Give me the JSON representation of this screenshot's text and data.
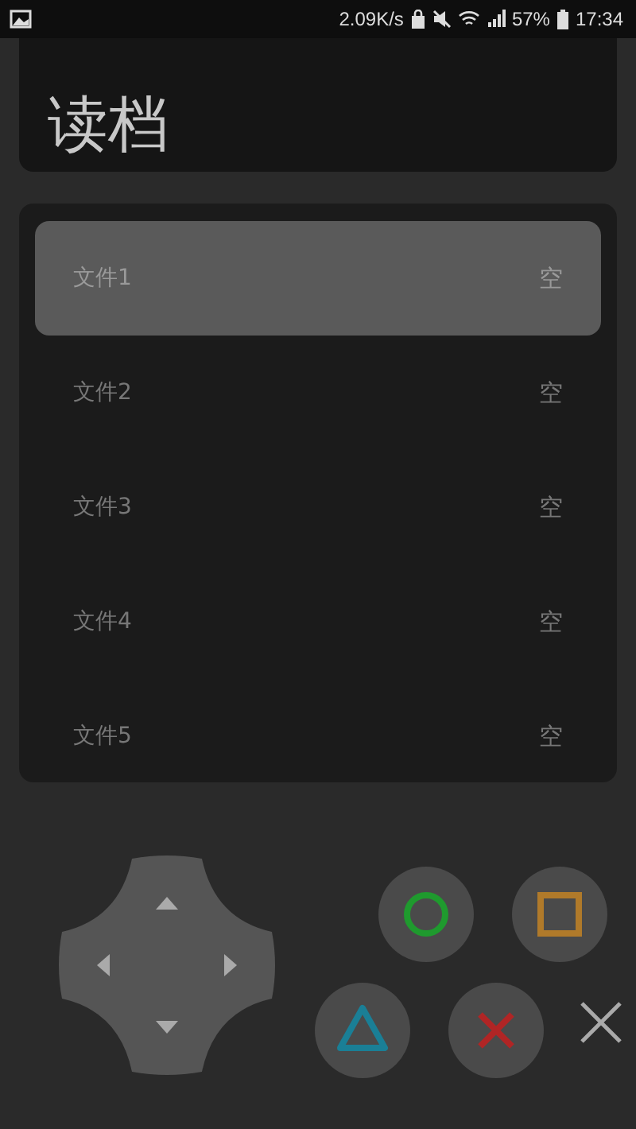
{
  "status_bar": {
    "speed": "2.09K/s",
    "battery": "57%",
    "time": "17:34"
  },
  "title": "读档",
  "slots": [
    {
      "name": "文件1",
      "status": "空",
      "selected": true
    },
    {
      "name": "文件2",
      "status": "空",
      "selected": false
    },
    {
      "name": "文件3",
      "status": "空",
      "selected": false
    },
    {
      "name": "文件4",
      "status": "空",
      "selected": false
    },
    {
      "name": "文件5",
      "status": "空",
      "selected": false
    }
  ],
  "face_buttons": [
    {
      "kind": "circle",
      "color": "#1f9a2e"
    },
    {
      "kind": "square",
      "color": "#b07a2a"
    },
    {
      "kind": "triangle",
      "color": "#1a7f96"
    },
    {
      "kind": "cross",
      "color": "#b02525"
    }
  ]
}
